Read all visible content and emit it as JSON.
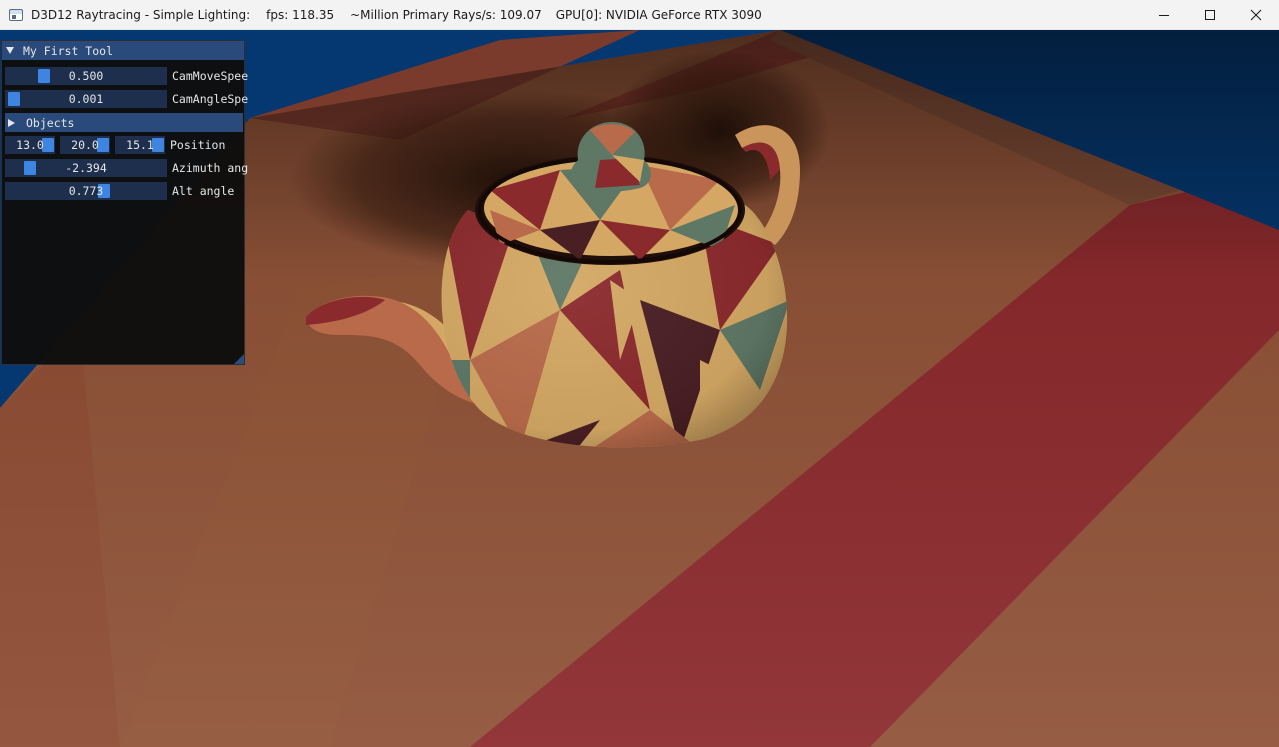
{
  "window": {
    "title_app": "D3D12 Raytracing - Simple Lighting:",
    "title_fps": "fps: 118.35",
    "title_rays": "~Million Primary Rays/s: 109.07",
    "title_gpu": "GPU[0]: NVIDIA GeForce RTX 3090",
    "controls": [
      "minimize-icon",
      "maximize-icon",
      "close-icon"
    ]
  },
  "tool_panel": {
    "title": "My First Tool",
    "cam_move_speed": {
      "value": "0.500",
      "label": "CamMoveSpee",
      "level": 0.5
    },
    "cam_angle_speed": {
      "value": "0.001",
      "label": "CamAngleSpe",
      "level": 0.0
    },
    "objects_header": "Objects",
    "position": {
      "x": "13.0",
      "y": "20.0",
      "z": "15.1",
      "label": "Position"
    },
    "azimuth": {
      "value": "-2.394",
      "label": "Azimuth ang"
    },
    "alt_angle": {
      "value": "0.773",
      "label": "Alt angle"
    }
  },
  "colors": {
    "accent": "#3d85e0",
    "panel_title_bg": "#294a7a",
    "sky": "#053870",
    "floor_brown": "#8f5338",
    "floor_red": "#8b2a2d"
  }
}
